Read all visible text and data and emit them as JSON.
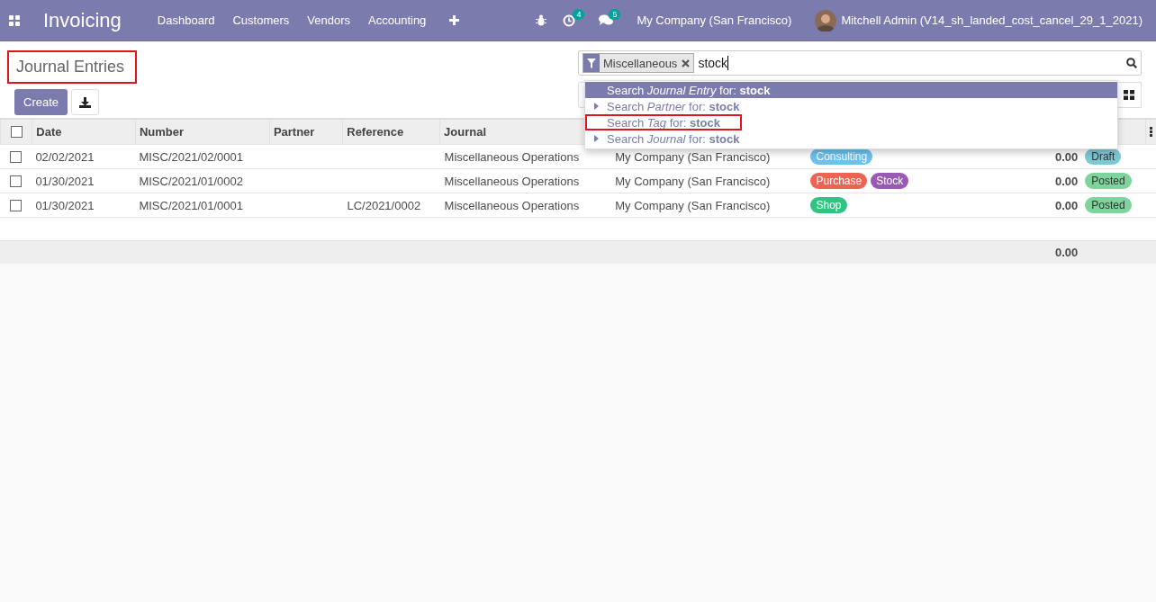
{
  "navbar": {
    "app_name": "Invoicing",
    "menu": [
      "Dashboard",
      "Customers",
      "Vendors",
      "Accounting"
    ],
    "activity_count": "4",
    "message_count": "5",
    "company": "My Company (San Francisco)",
    "user": "Mitchell Admin (V14_sh_landed_cost_cancel_29_1_2021)"
  },
  "page": {
    "title": "Journal Entries",
    "title_highlighted": true,
    "create_button": "Create"
  },
  "search": {
    "facet": "Miscellaneous",
    "value": "stock",
    "suggestions": [
      {
        "text": "Search *Journal Entry* for: **stock**",
        "selected": true,
        "expandable": false,
        "highlighted": false
      },
      {
        "text": "Search *Partner* for: **stock**",
        "selected": false,
        "expandable": true,
        "highlighted": false
      },
      {
        "text": "Search *Tag* for: **stock**",
        "selected": false,
        "expandable": false,
        "highlighted": true
      },
      {
        "text": "Search *Journal* for: **stock**",
        "selected": false,
        "expandable": true,
        "highlighted": false
      }
    ]
  },
  "table": {
    "select_all_checked": false,
    "columns": [
      "Date",
      "Number",
      "Partner",
      "Reference",
      "Journal"
    ],
    "rows": [
      {
        "checked": false,
        "date": "02/02/2021",
        "number": "MISC/2021/02/0001",
        "partner": "",
        "reference": "",
        "journal": "Miscellaneous Operations",
        "company": "My Company (San Francisco)",
        "tags": [
          {
            "label": "Consulting",
            "color": "#6cc1ed"
          }
        ],
        "total": "0.00",
        "status": {
          "label": "Draft",
          "color": "#7ec8d6"
        }
      },
      {
        "checked": false,
        "date": "01/30/2021",
        "number": "MISC/2021/01/0002",
        "partner": "",
        "reference": "",
        "journal": "Miscellaneous Operations",
        "company": "My Company (San Francisco)",
        "tags": [
          {
            "label": "Purchase",
            "color": "#ed6455"
          },
          {
            "label": "Stock",
            "color": "#9b59b6"
          }
        ],
        "total": "0.00",
        "status": {
          "label": "Posted",
          "color": "#7fd39c"
        }
      },
      {
        "checked": false,
        "date": "01/30/2021",
        "number": "MISC/2021/01/0001",
        "partner": "",
        "reference": "LC/2021/0002",
        "journal": "Miscellaneous Operations",
        "company": "My Company (San Francisco)",
        "tags": [
          {
            "label": "Shop",
            "color": "#30c381"
          }
        ],
        "total": "0.00",
        "status": {
          "label": "Posted",
          "color": "#7fd39c"
        }
      }
    ],
    "footer_total": "0.00"
  }
}
